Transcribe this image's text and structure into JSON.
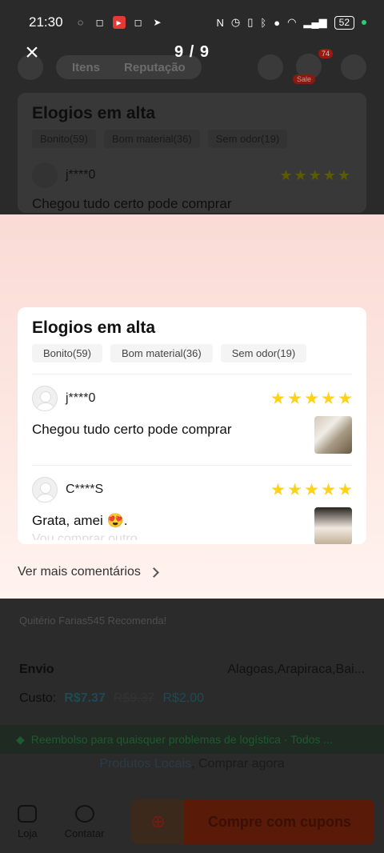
{
  "status_bar": {
    "time": "21:30",
    "battery": "52"
  },
  "viewer": {
    "counter": "9 / 9",
    "close_label": "×"
  },
  "background": {
    "pill_tabs": [
      "Itens",
      "Reputação"
    ],
    "cart_count": "74",
    "cart_sale": "Sale",
    "card_title": "Elogios em alta",
    "tags": [
      "Bonito(59)",
      "Bom material(36)",
      "Sem odor(19)"
    ],
    "first_name": "j****0",
    "first_comment": "Chegou tudo certo pode comprar",
    "recommend": "Quitério Farias545 Recomenda!",
    "envio_label": "Envio",
    "envio_location": "Alagoas,Arapiraca,Bai...",
    "custo_label": "Custo:",
    "price_current": "R$7.37",
    "price_old": "R$9.37",
    "price_discount": "R$2.00",
    "green_banner": "Reembolso para quaisquer problemas de logística · Todos ...",
    "produtos_locais": "Produtos Locais",
    "comprar_agora": ", Comprar agora",
    "nav_loja": "Loja",
    "nav_contatar": "Contatar",
    "buy_button": "Compre com cupons"
  },
  "image": {
    "title": "Elogios em alta",
    "tags": [
      "Bonito(59)",
      "Bom material(36)",
      "Sem odor(19)"
    ],
    "reviews": [
      {
        "name": "j****0",
        "rating": 5,
        "text": "Chegou tudo certo pode comprar"
      },
      {
        "name": "C****S",
        "rating": 5,
        "text": "Grata, amei 😍.",
        "faded": "Vou comprar outro"
      }
    ],
    "see_more": "Ver mais comentários"
  }
}
